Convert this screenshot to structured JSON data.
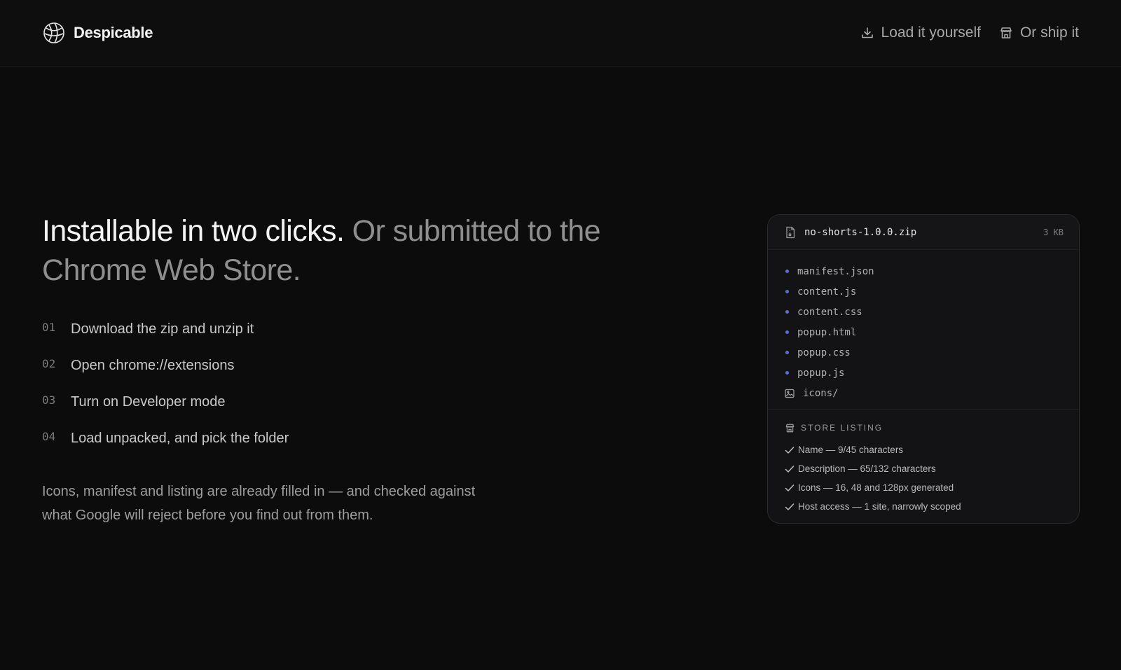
{
  "header": {
    "brand": "Despicable",
    "nav": [
      {
        "label": "Load it yourself",
        "icon": "download-icon"
      },
      {
        "label": "Or ship it",
        "icon": "store-icon"
      }
    ]
  },
  "hero": {
    "title_strong": "Installable in two clicks.",
    "title_muted": "Or submitted to the Chrome Web Store."
  },
  "steps": [
    {
      "num": "01",
      "text": "Download the zip and unzip it"
    },
    {
      "num": "02",
      "text": "Open chrome://extensions"
    },
    {
      "num": "03",
      "text": "Turn on Developer mode"
    },
    {
      "num": "04",
      "text": "Load unpacked, and pick the folder"
    }
  ],
  "note": "Icons, manifest and listing are already filled in — and checked against what Google will reject before you find out from them.",
  "package": {
    "filename": "no-shorts-1.0.0.zip",
    "size": "3 KB",
    "files": [
      "manifest.json",
      "content.js",
      "content.css",
      "popup.html",
      "popup.css",
      "popup.js"
    ],
    "folder": "icons/",
    "listing_title": "STORE LISTING",
    "checks": [
      "Name — 9/45 characters",
      "Description — 65/132 characters",
      "Icons — 16, 48 and 128px generated",
      "Host access — 1 site, narrowly scoped"
    ]
  },
  "colors": {
    "background": "#0c0c0d",
    "accent_dot": "#5b6fd6",
    "text_primary": "#f4f4f4",
    "text_muted": "#8f8f8f"
  }
}
